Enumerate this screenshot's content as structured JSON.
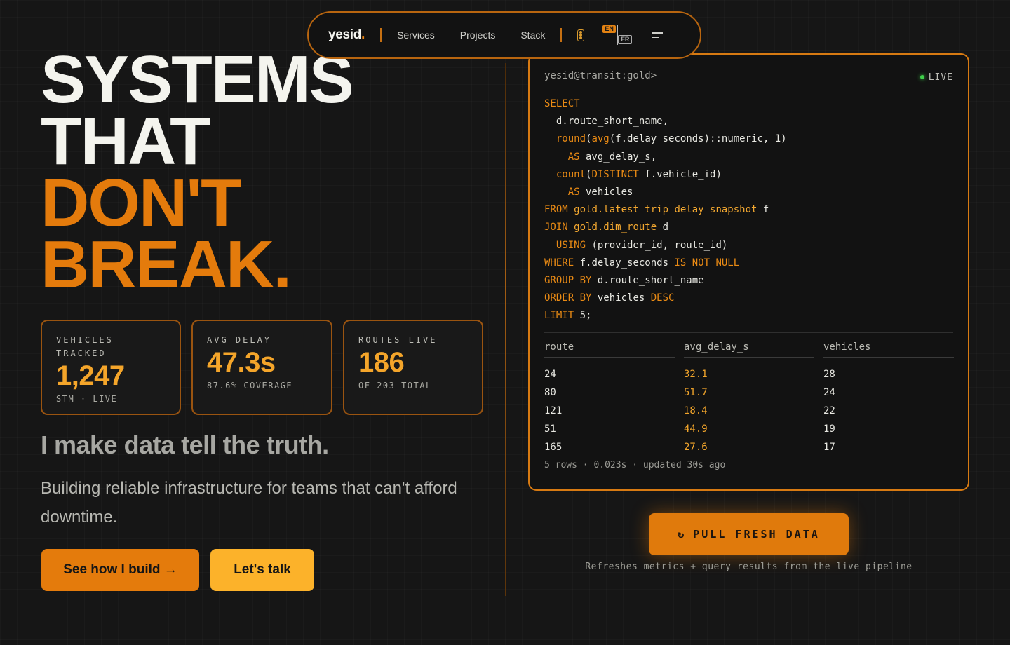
{
  "nav": {
    "brand": "yesid",
    "brand_dot": ".",
    "links": [
      "Services",
      "Projects",
      "Stack"
    ],
    "lang_active": "EN",
    "lang_alt": "FR"
  },
  "hero": {
    "line1": "SYSTEMS",
    "line2": "THAT",
    "line3": "DON'T",
    "line4": "BREAK.",
    "tagline": "I make data tell the truth.",
    "description": "Building reliable infrastructure for teams that can't afford downtime.",
    "cta_primary": "See how I build →",
    "cta_secondary": "Let's talk"
  },
  "stats": [
    {
      "label": "VEHICLES TRACKED",
      "value": "1,247",
      "sub": "STM · LIVE"
    },
    {
      "label": "AVG DELAY",
      "value": "47.3s",
      "sub": "87.6% COVERAGE"
    },
    {
      "label": "ROUTES LIVE",
      "value": "186",
      "sub": "OF 203 TOTAL"
    }
  ],
  "terminal": {
    "prompt": "yesid@transit:gold>",
    "live": "LIVE",
    "columns": [
      "route",
      "avg_delay_s",
      "vehicles"
    ],
    "rows": [
      [
        "24",
        "32.1",
        "28"
      ],
      [
        "80",
        "51.7",
        "24"
      ],
      [
        "121",
        "18.4",
        "22"
      ],
      [
        "51",
        "44.9",
        "19"
      ],
      [
        "165",
        "27.6",
        "17"
      ]
    ],
    "footer": "5 rows · 0.023s · updated 30s ago"
  },
  "action": {
    "button_icon": "↻",
    "button": "PULL FRESH DATA",
    "hint": "Refreshes metrics + query results from the live pipeline"
  },
  "colors": {
    "accent": "#e47b0c",
    "accent_light": "#fcb22a",
    "background": "#161616",
    "live": "#3fcf4a"
  }
}
